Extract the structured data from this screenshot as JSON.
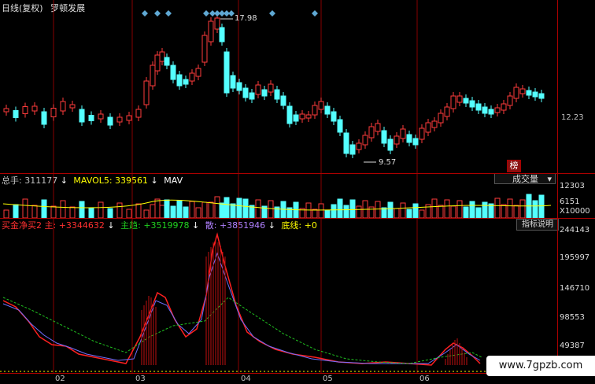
{
  "header": {
    "title": "日线(复权)",
    "stock_name": "罗顿发展"
  },
  "main_chart": {
    "high_label": "17.98",
    "low_label": "9.57",
    "price_tick": "12.23",
    "rank_badge": "榜",
    "dropdown_label": "成交量"
  },
  "volume_panel": {
    "total_label": "总手: 311177",
    "mavol5_label": "MAVOL5: 339561",
    "mav_label": "MAV",
    "ticks": [
      "12303",
      "6151",
      "X10000"
    ]
  },
  "indicator_panel": {
    "help_button": "指标说明",
    "l1": "买金净买2 主: +3344632",
    "l2": "主趋: +3519978",
    "l3": "散: +3851946",
    "l4": "底线: +0",
    "ticks": [
      "244143",
      "195997",
      "146710",
      "98553",
      "49387"
    ]
  },
  "x_axis": [
    "02",
    "03",
    "04",
    "05",
    "06"
  ],
  "watermark": "www.7gpzb.com",
  "colors": {
    "up": "#ff3b3b",
    "down": "#54ffff",
    "ma": "#ffff00",
    "main": "#ff2020",
    "trend": "#6f6fff",
    "retail": "#20c020",
    "text_green": "#20d020",
    "text_purple": "#b080ff"
  }
}
